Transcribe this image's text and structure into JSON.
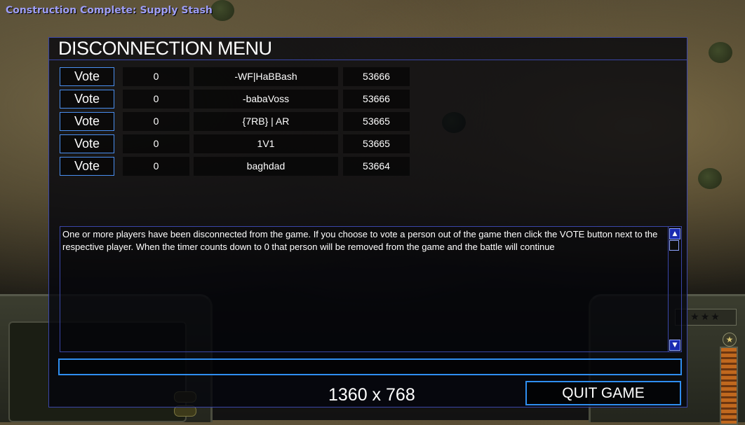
{
  "notification": "Construction Complete: Supply Stash",
  "dialog": {
    "title": "DISCONNECTION MENU",
    "players": [
      {
        "vote_label": "Vote",
        "count": "0",
        "name": "-WF|HaBBash",
        "ping": "53666"
      },
      {
        "vote_label": "Vote",
        "count": "0",
        "name": "-babaVoss",
        "ping": "53666"
      },
      {
        "vote_label": "Vote",
        "count": "0",
        "name": "{7RB} | AR",
        "ping": "53665"
      },
      {
        "vote_label": "Vote",
        "count": "0",
        "name": "1V1",
        "ping": "53665"
      },
      {
        "vote_label": "Vote",
        "count": "0",
        "name": "baghdad",
        "ping": "53664"
      }
    ],
    "message": "One or more players have been disconnected from the game. If you choose to vote a person out of the game then click the VOTE button next to the respective player. When the timer counts down to 0 that person will be removed from the game and the battle will continue",
    "chat_input_value": "",
    "resolution": "1360 x 768",
    "quit_label": "QUIT GAME"
  },
  "icons": {
    "scroll_up": "triangle-up-icon",
    "scroll_down": "triangle-down-icon",
    "rank": "star-icon",
    "power": "star-emblem-icon"
  },
  "colors": {
    "accent_border": "#2f8ef0",
    "frame_border": "#3a46a8",
    "notification_text": "#9e9ef5"
  }
}
